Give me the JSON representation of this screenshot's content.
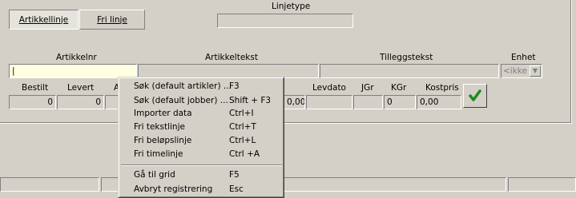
{
  "tabs": {
    "article_line": "Artikkellinje",
    "free_line": "Fri linje"
  },
  "linetype": {
    "label": "Linjetype",
    "value": ""
  },
  "fields": {
    "artikkelnr_label": "Artikkelnr",
    "artikkeltekst_label": "Artikkeltekst",
    "tilleggstekst_label": "Tilleggstekst",
    "enhet_label": "Enhet",
    "enhet_value": "<ikke"
  },
  "row2": {
    "bestilt_label": "Bestilt",
    "bestilt_value": "0",
    "levert_label": "Levert",
    "levert_value": "0",
    "a_label": "A",
    "price_value": "0,00",
    "levdato_label": "Levdato",
    "jgr_label": "JGr",
    "kgr_label": "KGr",
    "kgr_value": "0",
    "kostpris_label": "Kostpris",
    "kostpris_value": "0,00"
  },
  "context_menu": {
    "items": [
      {
        "label": "Søk (default artikler) ...",
        "shortcut": "F3"
      },
      {
        "label": "Søk (default jobber) ...",
        "shortcut": "Shift + F3"
      },
      {
        "label": "Importer data",
        "shortcut": "Ctrl+I"
      },
      {
        "label": "Fri tekstlinje",
        "shortcut": "Ctrl+T"
      },
      {
        "label": "Fri beløpslinje",
        "shortcut": "Ctrl+L"
      },
      {
        "label": "Fri timelinje",
        "shortcut": "Ctrl +A"
      },
      {
        "label": "Gå til grid",
        "shortcut": "F5"
      },
      {
        "label": "Avbryt registrering",
        "shortcut": "Esc"
      }
    ]
  },
  "icons": {
    "ok": "green-check-icon",
    "dropdown": "triangle-down-icon"
  },
  "colors": {
    "face": "#d4d0c8",
    "input_yellow": "#ffffe1",
    "check_green": "#1f8a1f"
  }
}
